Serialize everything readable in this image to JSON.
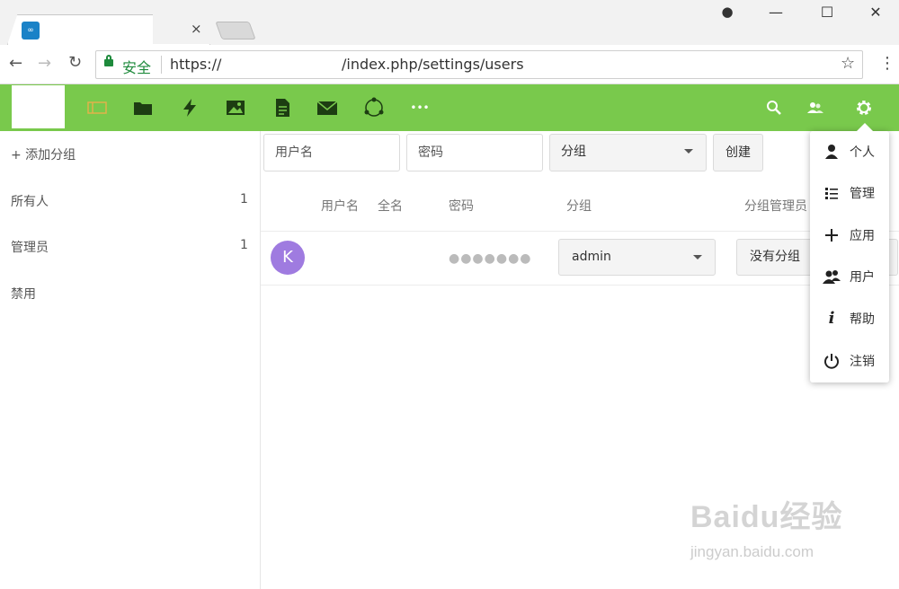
{
  "browser": {
    "tab_icon": "nextcloud-icon",
    "tab_close": "×",
    "win_controls": {
      "account": "●",
      "minimize": "—",
      "maximize": "☐",
      "close": "✕"
    },
    "nav": {
      "back": "←",
      "forward": "→",
      "reload": "↻"
    },
    "secure_label": "安全",
    "url_prefix": "https://",
    "url_path": "/index.php/settings/users",
    "star": "☆",
    "menu": "⋮"
  },
  "topbar": {
    "color": "#79c94c",
    "apps": [
      "dashboard-icon",
      "files-icon",
      "activity-icon",
      "gallery-icon",
      "notes-icon",
      "mail-icon",
      "circles-icon",
      "more-apps-icon"
    ],
    "more_label": "•••",
    "right": [
      "search-icon",
      "contacts-icon",
      "settings-gear-icon"
    ]
  },
  "sidebar": {
    "add_group": "+  添加分组",
    "items": [
      {
        "label": "所有人",
        "count": "1"
      },
      {
        "label": "管理员",
        "count": "1"
      },
      {
        "label": "禁用",
        "count": ""
      }
    ]
  },
  "new_user_form": {
    "username_placeholder": "用户名",
    "password_placeholder": "密码",
    "group_select": "分组",
    "create_button": "创建"
  },
  "table": {
    "headers": {
      "username": "用户名",
      "fullname": "全名",
      "password": "密码",
      "groups": "分组",
      "subadmin": "分组管理员"
    },
    "rows": [
      {
        "avatar_letter": "K",
        "avatar_color": "#9f7be0",
        "password_mask": "●●●●●●●",
        "group": "admin",
        "subadmin": "没有分组"
      }
    ]
  },
  "settings_menu": {
    "items": [
      {
        "label": "个人",
        "icon": "person-icon"
      },
      {
        "label": "管理",
        "icon": "list-icon"
      },
      {
        "label": "应用",
        "icon": "plus-icon"
      },
      {
        "label": "用户",
        "icon": "users-icon"
      },
      {
        "label": "帮助",
        "icon": "info-icon"
      },
      {
        "label": "注销",
        "icon": "power-icon"
      }
    ]
  },
  "watermark": {
    "line1": "Baidu经验",
    "line2": "jingyan.baidu.com"
  }
}
